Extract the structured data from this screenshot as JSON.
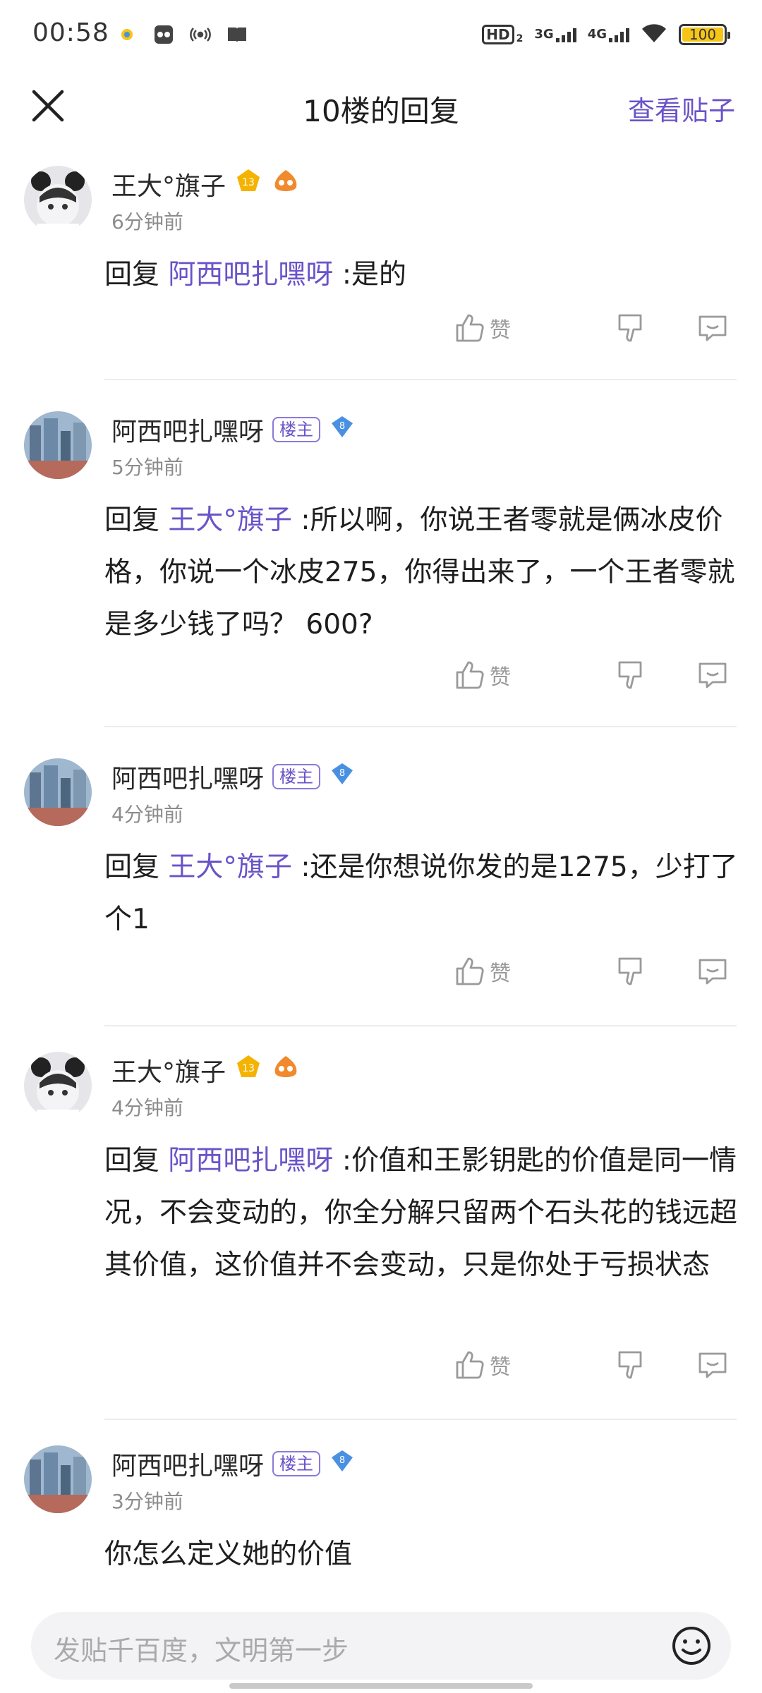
{
  "status_bar": {
    "time": "00:58",
    "network_1": "3G",
    "network_2": "4G",
    "hd_label": "HD",
    "hd_sub": "2",
    "battery": "100",
    "icons": [
      "app-notification-icon",
      "game-icon",
      "nfc-icon",
      "book-icon",
      "wifi-icon",
      "battery-icon"
    ]
  },
  "header": {
    "title": "10楼的回复",
    "view_post": "查看贴子"
  },
  "reply_prefix": "回复",
  "like_label": "赞",
  "owner_badge": "楼主",
  "replies": [
    {
      "user": "王大°旗子",
      "level": "13",
      "time": "6分钟前",
      "mention": "阿西吧扎嘿呀",
      "text": ":是的"
    },
    {
      "user": "阿西吧扎嘿呀",
      "level": "8",
      "time": "5分钟前",
      "mention": "王大°旗子",
      "text": ":所以啊，你说王者零就是俩冰皮价格，你说一个冰皮275，你得出来了，一个王者零就是多少钱了吗？ 600?"
    },
    {
      "user": "阿西吧扎嘿呀",
      "level": "8",
      "time": "4分钟前",
      "mention": "王大°旗子",
      "text": ":还是你想说你发的是1275，少打了个1"
    },
    {
      "user": "王大°旗子",
      "level": "13",
      "time": "4分钟前",
      "mention": "阿西吧扎嘿呀",
      "text": ":价值和王影钥匙的价值是同一情况，不会变动的，你全分解只留两个石头花的钱远超其价值，这价值并不会变动，只是你处于亏损状态"
    },
    {
      "user": "阿西吧扎嘿呀",
      "level": "8",
      "time": "3分钟前",
      "text": "你怎么定义她的价值"
    }
  ],
  "input": {
    "placeholder": "发贴千百度，文明第一步"
  },
  "colors": {
    "accent": "#6a54c8",
    "level_gold": "#f5b301",
    "level_blue": "#4a90e2"
  }
}
